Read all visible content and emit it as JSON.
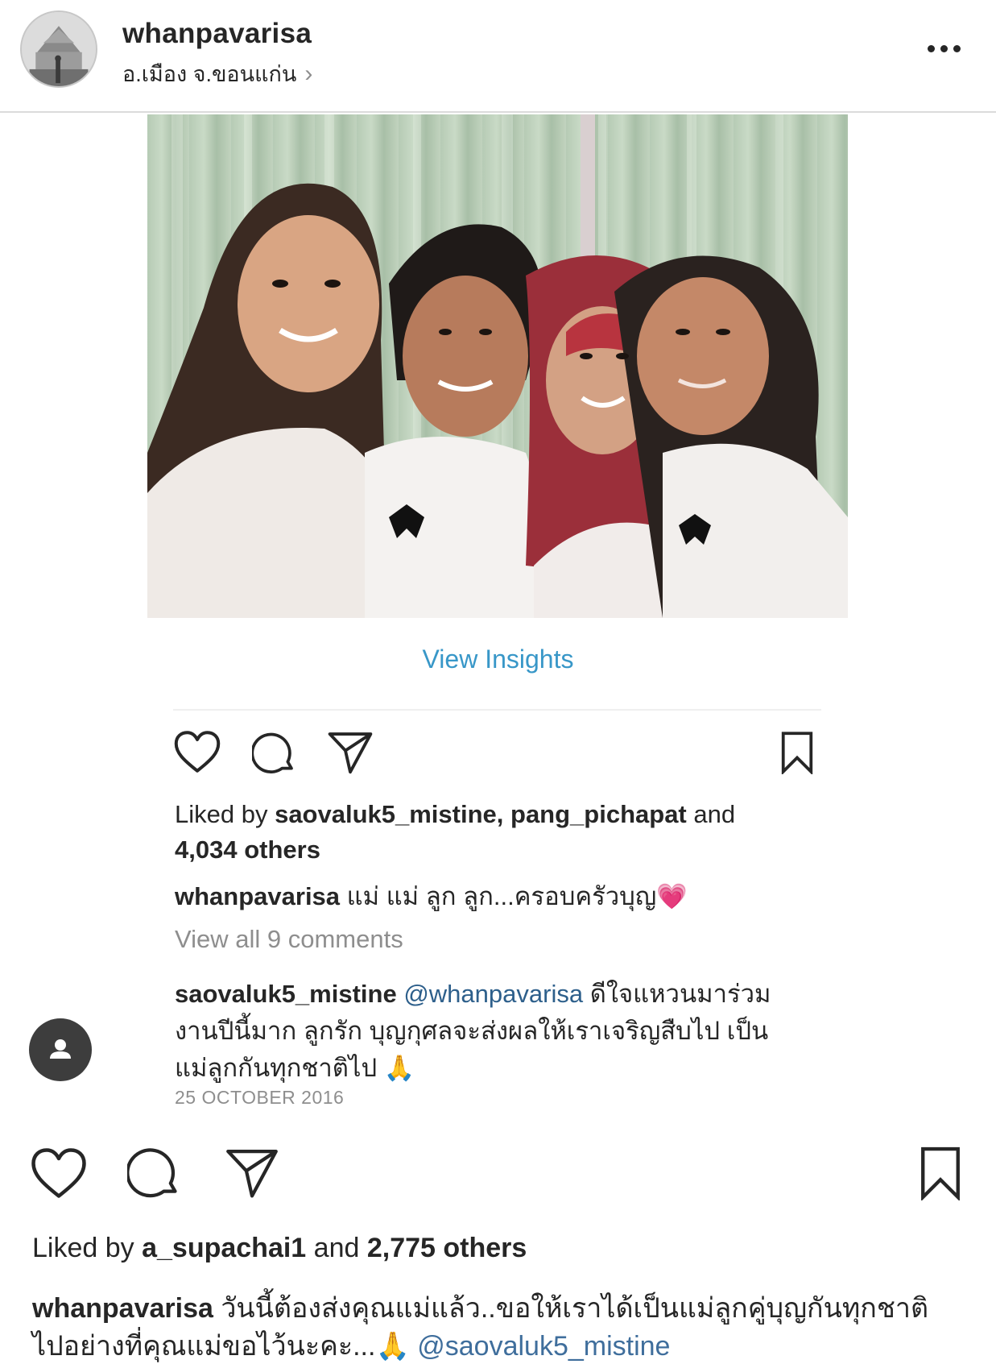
{
  "header": {
    "username": "whanpavarisa",
    "location": "อ.เมือง จ.ขอนแก่น",
    "location_chevron": "›",
    "more_icon": "more-horizontal-icon"
  },
  "inner_post": {
    "view_insights": "View Insights",
    "liked_prefix": "Liked by ",
    "liked_users": "saovaluk5_mistine, pang_pichapat",
    "liked_and": " and",
    "liked_others": "4,034 others",
    "caption_user": "whanpavarisa",
    "caption_text": " แม่ แม่ ลูก ลูก...ครอบครัวบุญ",
    "caption_emoji": "💗",
    "view_comments": "View all 9 comments",
    "comment_user": "saovaluk5_mistine",
    "comment_mention": " @whanpavarisa",
    "comment_line1": " ดีใจแหวนมาร่วม",
    "comment_line2": "งานปีนี้มาก ลูกรัก บุญกุศลจะส่งผลให้เราเจริญสืบไป เป็น",
    "comment_line3": "แม่ลูกกันทุกชาติไป",
    "comment_emoji": "🙏",
    "date": "25 OCTOBER 2016"
  },
  "outer_post": {
    "liked_prefix": "Liked by ",
    "liked_user": "a_supachai1",
    "liked_and": " and ",
    "liked_others": "2,775 others",
    "caption_user": "whanpavarisa",
    "caption_line1": " วันนี้ต้องส่งคุณแม่แล้ว..ขอให้เราได้เป็นแม่ลูกคู่บุญกันทุกชาติ",
    "caption_line2": "ไปอย่างที่คุณแม่ขอไว้นะคะ...",
    "caption_emoji": "🙏",
    "caption_mention": " @saovaluk5_mistine"
  },
  "colors": {
    "link_blue": "#3897c8",
    "text": "#262626",
    "muted": "#8e8e8e",
    "fab": "#3d3d3d"
  }
}
